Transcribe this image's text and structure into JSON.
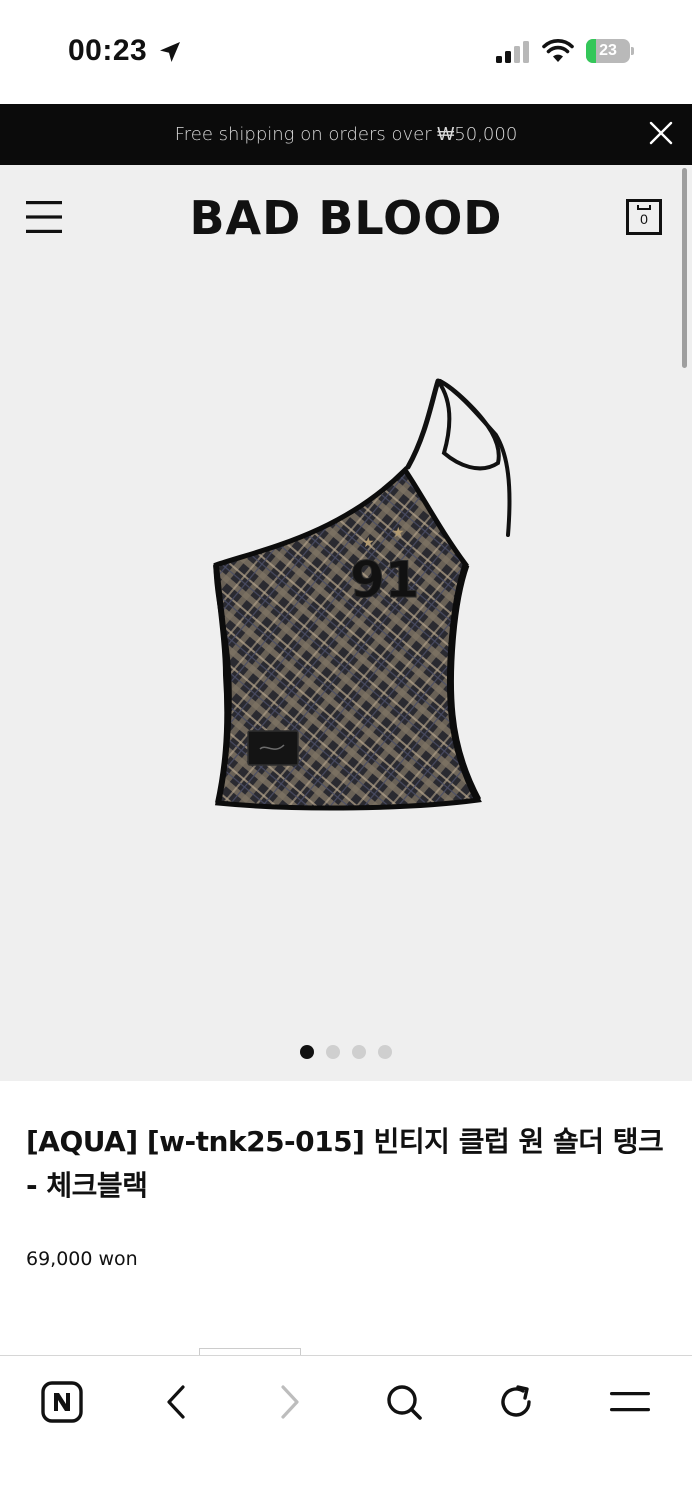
{
  "status": {
    "time": "00:23",
    "battery": "23",
    "battery_level": 0.23
  },
  "announcement": {
    "text": "Free shipping on orders over ₩50,000"
  },
  "header": {
    "brand": "BAD BLOOD",
    "cart_count": "0"
  },
  "gallery": {
    "slide_count": 4,
    "active_slide": 1,
    "jersey_number": "91"
  },
  "product": {
    "title": "[AQUA] [w-tnk25-015] 빈티지 클럽 원 숄더 탱크 - 체크블랙",
    "price": "69,000 won"
  },
  "icons": {
    "menu": "hamburger-menu-icon",
    "cart": "shopping-bag-icon",
    "close": "close-icon",
    "browser_home": "naver-n-icon",
    "back": "chevron-left-icon",
    "forward": "chevron-right-icon",
    "search": "search-icon",
    "reload": "reload-icon",
    "more": "menu-lines-icon"
  },
  "colors": {
    "announcement_bg": "#0b0b0b",
    "gallery_bg": "#efefef",
    "battery_green": "#34c759"
  }
}
